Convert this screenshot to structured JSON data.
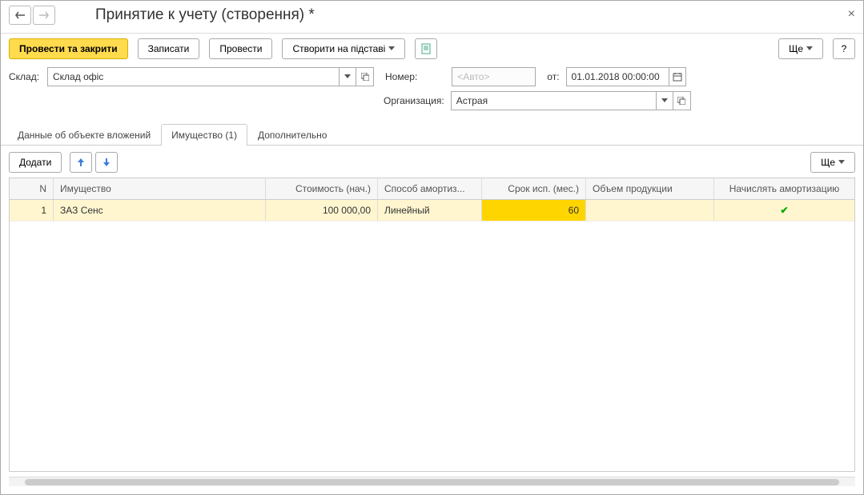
{
  "title": "Принятие к учету (створення) *",
  "nav": {
    "back": "←",
    "forward": "→"
  },
  "toolbar": {
    "post_and_close": "Провести та закрити",
    "save": "Записати",
    "post": "Провести",
    "create_based_on": "Створити на підставі",
    "more": "Ще",
    "help": "?"
  },
  "form": {
    "warehouse_label": "Склад:",
    "warehouse_value": "Склад офіс",
    "number_label": "Номер:",
    "number_placeholder": "<Авто>",
    "date_label": "от:",
    "date_value": "01.01.2018 00:00:00",
    "org_label": "Организация:",
    "org_value": "Астрая"
  },
  "tabs": {
    "t1": "Данные об объекте вложений",
    "t2": "Имущество (1)",
    "t3": "Дополнительно"
  },
  "tabToolbar": {
    "add": "Додати",
    "more": "Ще"
  },
  "grid": {
    "headers": {
      "n": "N",
      "name": "Имущество",
      "cost": "Стоимость (нач.)",
      "method": "Способ амортиз...",
      "term": "Срок исп. (мес.)",
      "volume": "Объем продукции",
      "amort": "Начислять амортизацию"
    },
    "rows": [
      {
        "n": "1",
        "name": "ЗАЗ Сенс",
        "cost": "100 000,00",
        "method": "Линейный",
        "term": "60",
        "volume": "",
        "amort": true
      }
    ]
  }
}
